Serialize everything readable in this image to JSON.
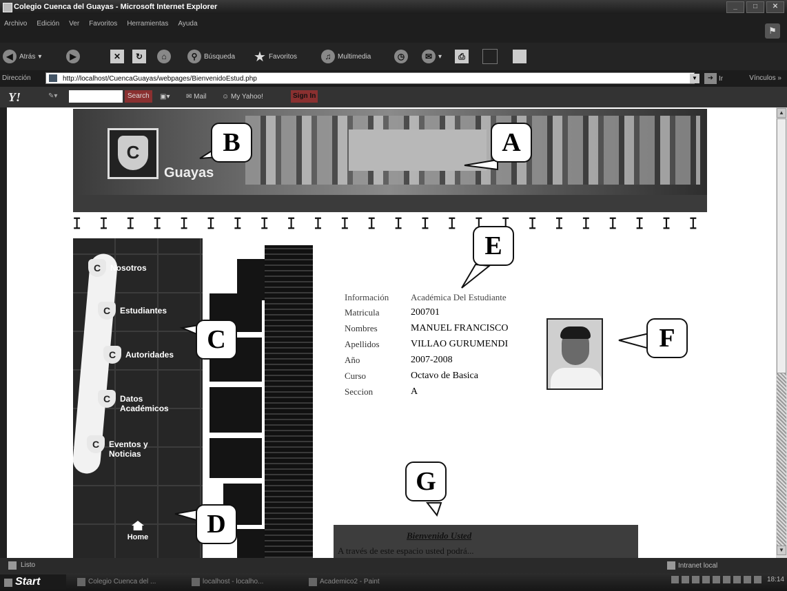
{
  "window": {
    "title": "Colegio Cuenca del Guayas - Microsoft Internet Explorer",
    "controls": [
      "_",
      "□",
      "✕"
    ]
  },
  "menubar": {
    "items": [
      "Archivo",
      "Edición",
      "Ver",
      "Favoritos",
      "Herramientas",
      "Ayuda"
    ]
  },
  "toolbar": {
    "back": "Atrás",
    "search": "Búsqueda",
    "favorites": "Favoritos",
    "multimedia": "Multimedia"
  },
  "address": {
    "label": "Dirección",
    "url": "http://localhost/CuencaGuayas/webpages/BienvenidoEstud.php",
    "go": "Ir",
    "links": "Vínculos »"
  },
  "yahoo": {
    "logo": "Y!",
    "search_button": "Search",
    "mail": "Mail",
    "my_yahoo": "My Yahoo!",
    "sign_in": "Sign In"
  },
  "banner": {
    "school_name": "Guayas"
  },
  "decor_row": "ꕯ ꕯ ꕯ ꕯ ꕯ ꕯ ꕯ ꕯ ꕯ ꕯ ꕯ ꕯ ꕯ ꕯ ꕯ ꕯ ꕯ ꕯ ꕯ ꕯ ꕯ ꕯ ꕯ ꕯ ꕯ ꕯ ꕯ ꕯ",
  "nav": {
    "items": [
      "Nosotros",
      "Estudiantes",
      "Autoridades",
      "Datos Académicos",
      "Eventos y Noticias"
    ],
    "home": "Home"
  },
  "student": {
    "header_key": "Información",
    "header_value": "Académica Del Estudiante",
    "rows": [
      {
        "label": "Matricula",
        "value": "200701"
      },
      {
        "label": "Nombres",
        "value": "MANUEL FRANCISCO"
      },
      {
        "label": "Apellidos",
        "value": "VILLAO GURUMENDI"
      },
      {
        "label": "Año",
        "value": "2007-2008"
      },
      {
        "label": "Curso",
        "value": "Octavo de Basica"
      },
      {
        "label": "Seccion",
        "value": "A"
      }
    ]
  },
  "welcome": {
    "title": "Bienvenido Usted",
    "text": "A través de este espacio usted podrá..."
  },
  "callouts": {
    "a": "A",
    "b": "B",
    "c": "C",
    "d": "D",
    "e": "E",
    "f": "F",
    "g": "G"
  },
  "status": {
    "text": "Listo",
    "zone": "Intranet local"
  },
  "taskbar": {
    "start": "Start",
    "tasks": [
      "Colegio Cuenca del ...",
      "localhost - localho...",
      "Academico2 - Paint"
    ],
    "clock": "18:14"
  }
}
